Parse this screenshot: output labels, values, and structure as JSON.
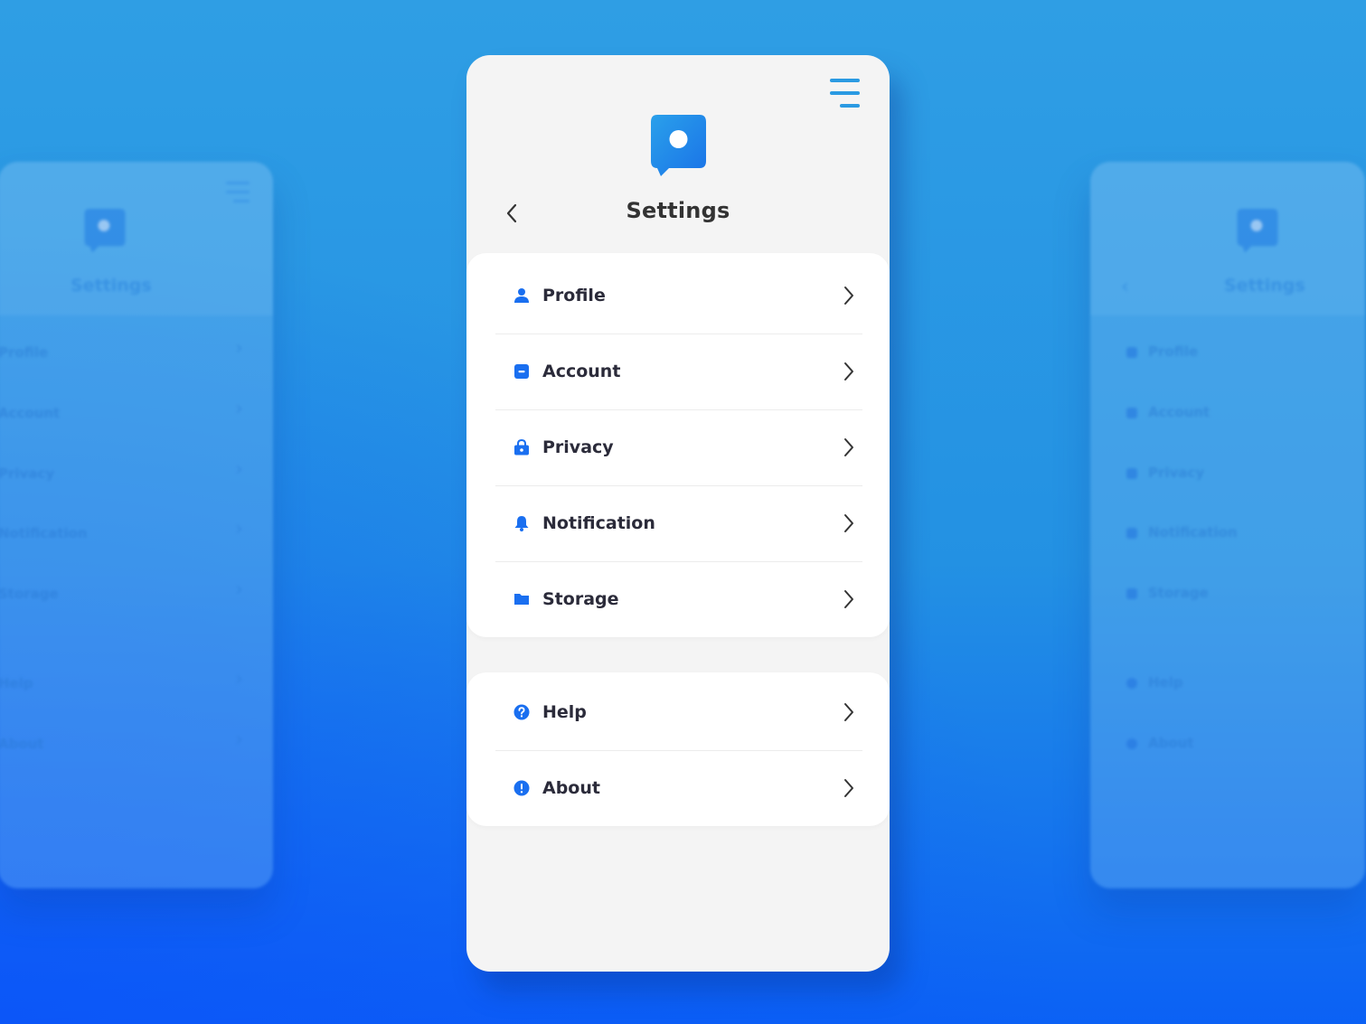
{
  "screen": {
    "title": "Settings"
  },
  "icons": {
    "menu": "hamburger-menu-icon",
    "logo": "chat-bubble-logo-icon",
    "back": "chevron-left-icon",
    "chevron": "chevron-right-icon"
  },
  "colors": {
    "accent": "#1a73e8",
    "menu_accent": "#2a9ae2",
    "text_primary": "#2b2b3a",
    "card_bg": "#ffffff",
    "screen_bg": "#f4f4f4"
  },
  "menu": {
    "group1": [
      {
        "label": "Profile",
        "icon": "person-icon"
      },
      {
        "label": "Account",
        "icon": "account-card-icon"
      },
      {
        "label": "Privacy",
        "icon": "lock-icon"
      },
      {
        "label": "Notification",
        "icon": "bell-icon"
      },
      {
        "label": "Storage",
        "icon": "folder-icon"
      }
    ],
    "group2": [
      {
        "label": "Help",
        "icon": "help-circle-icon"
      },
      {
        "label": "About",
        "icon": "info-circle-icon"
      }
    ]
  },
  "background_panels": {
    "left": {
      "title": "Settings",
      "items": [
        "Profile",
        "Account",
        "Privacy",
        "Notification",
        "Storage",
        "Help",
        "About"
      ]
    },
    "right": {
      "title": "Settings",
      "items": [
        "Profile",
        "Account",
        "Privacy",
        "Notification",
        "Storage",
        "Help",
        "About"
      ]
    }
  }
}
